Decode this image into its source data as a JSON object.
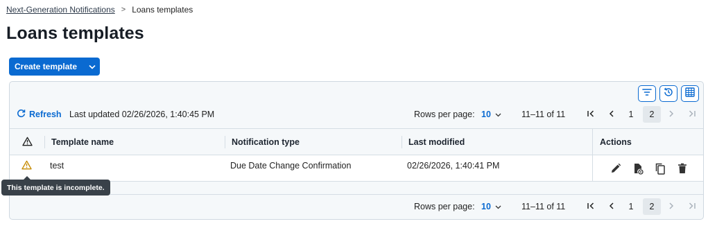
{
  "breadcrumb": {
    "parent": "Next-Generation Notifications",
    "separator": ">",
    "current": "Loans templates"
  },
  "page_title": "Loans templates",
  "create_button": {
    "label": "Create template",
    "icon": "chevron-down-icon"
  },
  "toolbar": {
    "tool_icons": [
      "filter-icon",
      "history-icon",
      "columns-icon"
    ],
    "refresh_label": "Refresh",
    "last_updated_label": "Last updated",
    "last_updated_value": "02/26/2026, 1:40:45 PM"
  },
  "pagination": {
    "rows_per_page_label": "Rows per page:",
    "rows_per_page_value": "10",
    "range": "11–11 of 11",
    "pages": [
      "1",
      "2"
    ],
    "current_page": "2"
  },
  "table": {
    "columns": [
      "Template name",
      "Notification type",
      "Last modified",
      "Actions"
    ],
    "warning_header_icon": "warning-icon",
    "rows": [
      {
        "status_icon": "warning-icon",
        "template_name": "test",
        "notification_type": "Due Date Change Confirmation",
        "last_modified": "02/26/2026, 1:40:41 PM",
        "actions": [
          "edit-icon",
          "preview-icon",
          "copy-icon",
          "delete-icon"
        ]
      }
    ]
  },
  "tooltip": "This template is incomplete.",
  "colors": {
    "accent": "#0a6ad1",
    "warning": "#c58a00",
    "title": "#171d25"
  }
}
